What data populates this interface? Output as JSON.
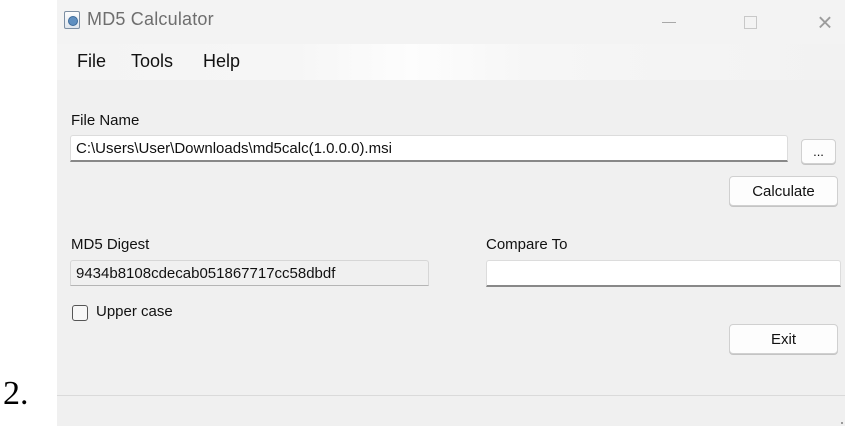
{
  "list_marker": "2.",
  "window": {
    "title": "MD5 Calculator",
    "icon": "md5-app-icon",
    "controls": {
      "minimize": "minimize-icon",
      "maximize": "maximize-icon",
      "close": "×"
    }
  },
  "menu": {
    "items": [
      {
        "label": "File"
      },
      {
        "label": "Tools"
      },
      {
        "label": "Help"
      }
    ]
  },
  "file": {
    "label": "File Name",
    "value": "C:\\Users\\User\\Downloads\\md5calc(1.0.0.0).msi",
    "browse_label": "...",
    "calculate_label": "Calculate"
  },
  "digest": {
    "label": "MD5 Digest",
    "value": "9434b8108cdecab051867717cc58dbdf",
    "uppercase_label": "Upper case",
    "uppercase_checked": false
  },
  "compare": {
    "label": "Compare To",
    "value": ""
  },
  "exit_label": "Exit"
}
